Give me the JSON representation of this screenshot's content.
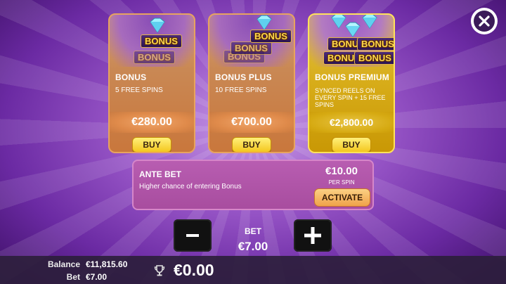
{
  "offers": [
    {
      "title": "BONUS",
      "description": "5 FREE SPINS",
      "price": "€280.00",
      "buy_label": "BUY",
      "badge_text": "BONUS",
      "tier": "bronze"
    },
    {
      "title": "BONUS PLUS",
      "description": "10 FREE SPINS",
      "price": "€700.00",
      "buy_label": "BUY",
      "badge_text": "BONUS",
      "tier": "bronze"
    },
    {
      "title": "BONUS PREMIUM",
      "description": "SYNCED REELS ON EVERY SPIN + 15 FREE SPINS",
      "price": "€2,800.00",
      "buy_label": "BUY",
      "badge_text": "BONUS",
      "tier": "gold"
    }
  ],
  "ante": {
    "title": "ANTE BET",
    "description": "Higher chance of entering Bonus",
    "price": "€10.00",
    "per_spin": "PER SPIN",
    "activate_label": "ACTIVATE"
  },
  "bet_control": {
    "label": "BET",
    "value": "€7.00",
    "decrease_symbol": "-",
    "increase_symbol": "+"
  },
  "footer": {
    "balance_label": "Balance",
    "balance_value": "€11,815.60",
    "bet_label": "Bet",
    "bet_value": "€7.00",
    "win_value": "€0.00"
  },
  "colors": {
    "bronze_card": "#c98854",
    "gold_card": "#d7ac19",
    "buy_button": "#f4c71e",
    "ante_panel": "#a84d9f",
    "activate_button": "#f0a24a"
  },
  "icons": [
    "close-icon",
    "diamond-icon",
    "minus-icon",
    "plus-icon",
    "trophy-icon"
  ]
}
